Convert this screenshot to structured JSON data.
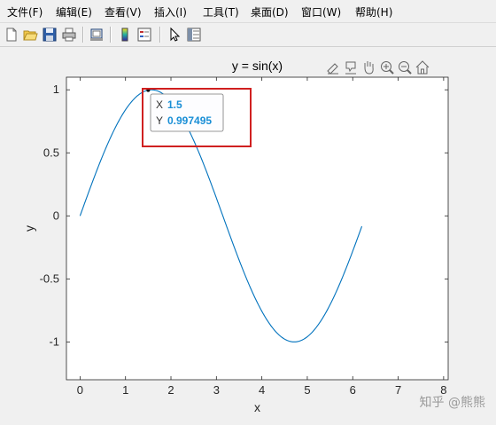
{
  "menu": [
    {
      "label": "文件(F)"
    },
    {
      "label": "编辑(E)"
    },
    {
      "label": "查看(V)"
    },
    {
      "label": "插入(I)"
    },
    {
      "label": "工具(T)"
    },
    {
      "label": "桌面(D)"
    },
    {
      "label": "窗口(W)"
    },
    {
      "label": "帮助(H)"
    }
  ],
  "toolbar_icons": [
    "new-figure-icon",
    "open-file-icon",
    "save-icon",
    "print-icon",
    "link-plot-icon",
    "colorbar-icon",
    "legend-icon",
    "pointer-icon",
    "property-inspector-icon"
  ],
  "axes_toolbar_icons": [
    "brush-icon",
    "data-tips-icon",
    "pan-icon",
    "zoom-in-icon",
    "zoom-out-icon",
    "home-icon"
  ],
  "datatip": {
    "x_label": "X",
    "x_value": "1.5",
    "y_label": "Y",
    "y_value": "0.997495"
  },
  "watermark": "知乎 @熊熊",
  "colors": {
    "line": "#0072bd",
    "datatip_value": "#1a8fd6",
    "highlight_box": "#d02020"
  },
  "chart_data": {
    "type": "line",
    "title": "y = sin(x)",
    "xlabel": "x",
    "ylabel": "y",
    "xlim": [
      -0.3,
      8.1
    ],
    "ylim": [
      -1.3,
      1.1
    ],
    "xticks": [
      0,
      1,
      2,
      3,
      4,
      5,
      6,
      7,
      8
    ],
    "yticks": [
      -1,
      -0.5,
      0,
      0.5,
      1
    ],
    "xtick_labels": [
      "0",
      "1",
      "2",
      "3",
      "4",
      "5",
      "6",
      "7",
      "8"
    ],
    "ytick_labels": [
      "-1",
      "-0.5",
      "0",
      "0.5",
      "1"
    ],
    "grid": false,
    "series": [
      {
        "function": "sin(x)",
        "x_start": 0,
        "x_end": 6.2,
        "x_step": 0.1
      }
    ],
    "datatip_point": {
      "x": 1.5,
      "y": 0.997495
    }
  }
}
